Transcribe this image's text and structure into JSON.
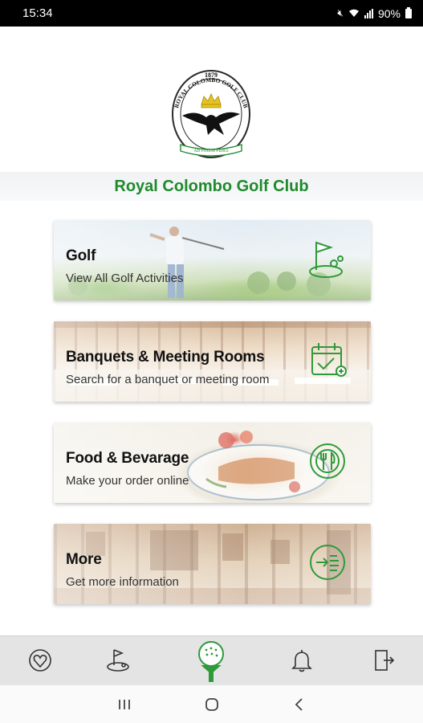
{
  "status_bar": {
    "time": "15:34",
    "battery": "90%"
  },
  "header": {
    "club_name": "Royal Colombo Golf Club"
  },
  "logo": {
    "year": "1879",
    "ring_text": "ROYAL COLOMBO GOLF CLUB",
    "motto": "AD FINEM FIDES"
  },
  "cards": [
    {
      "title": "Golf",
      "subtitle": "View All Golf Activities",
      "icon": "golf-flag-icon"
    },
    {
      "title": "Banquets & Meeting Rooms",
      "subtitle": "Search for a banquet or meeting room",
      "icon": "calendar-check-icon"
    },
    {
      "title": "Food & Bevarage",
      "subtitle": "Make your order online",
      "icon": "fork-knife-plate-icon"
    },
    {
      "title": "More",
      "subtitle": "Get more information",
      "icon": "menu-arrow-icon"
    }
  ],
  "tabbar": {
    "items": [
      "heart-badge-icon",
      "golf-putt-icon",
      "golf-ball-tee-icon",
      "bell-icon",
      "logout-icon"
    ],
    "active": "golf-ball-tee-icon"
  },
  "colors": {
    "brand_green": "#1e8a2c",
    "icon_green": "#2e9a3a"
  }
}
